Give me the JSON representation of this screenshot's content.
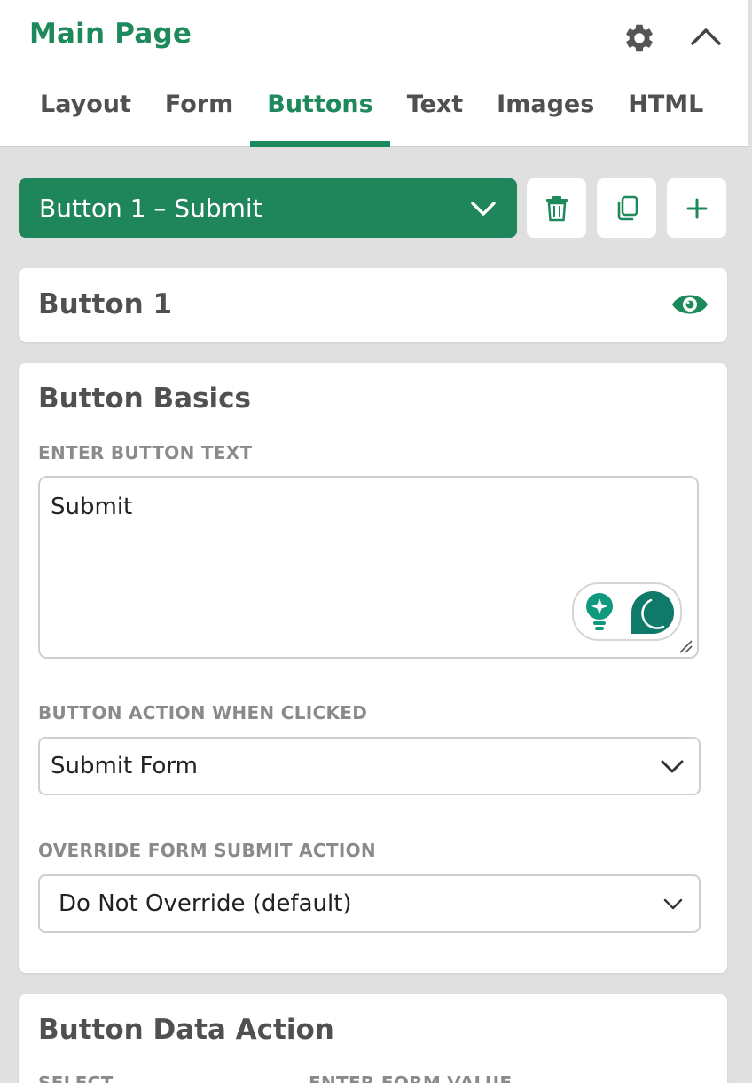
{
  "header": {
    "title": "Main Page",
    "tabs": [
      {
        "label": "Layout"
      },
      {
        "label": "Form"
      },
      {
        "label": "Buttons"
      },
      {
        "label": "Text"
      },
      {
        "label": "Images"
      },
      {
        "label": "HTML"
      }
    ],
    "active_tab": "Buttons"
  },
  "toolbar": {
    "selected_button": "Button 1 – Submit",
    "icons": [
      "trash-icon",
      "copy-icon",
      "plus-icon"
    ]
  },
  "button_card": {
    "title": "Button 1"
  },
  "basics": {
    "title": "Button Basics",
    "text_label": "ENTER BUTTON TEXT",
    "text_value": "Submit",
    "action_label": "BUTTON ACTION WHEN CLICKED",
    "action_value": "Submit Form",
    "override_label": "OVERRIDE FORM SUBMIT ACTION",
    "override_value": "Do Not Override (default)"
  },
  "data_action": {
    "title": "Button Data Action",
    "select_label": "SELECT",
    "value_label": "ENTER FORM VALUE"
  },
  "colors": {
    "accent": "#1e8a5c",
    "background": "#e0e0e0",
    "assist_teal": "#0f7a6a"
  }
}
